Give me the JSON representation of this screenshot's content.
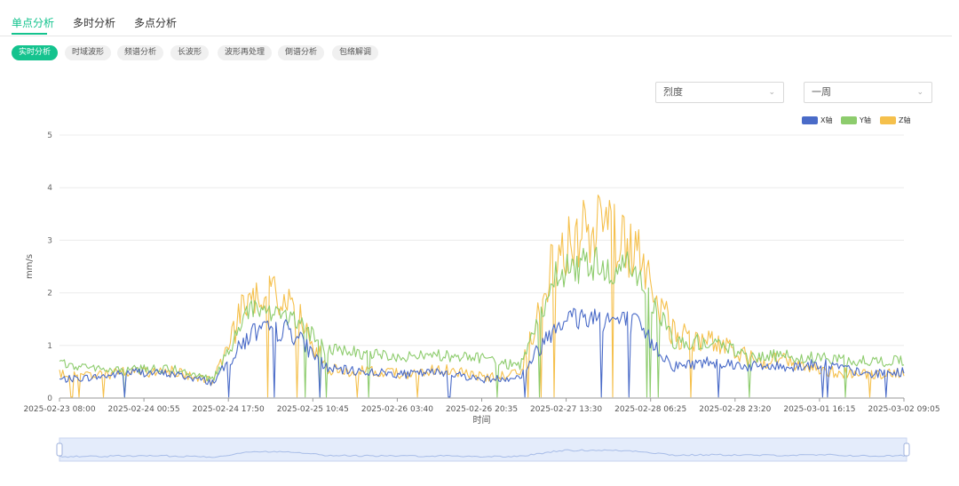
{
  "tabs": [
    {
      "label": "单点分析",
      "active": true
    },
    {
      "label": "多时分析",
      "active": false
    },
    {
      "label": "多点分析",
      "active": false
    }
  ],
  "subtabs": [
    {
      "label": "实时分析",
      "active": true
    },
    {
      "label": "时域波形",
      "active": false
    },
    {
      "label": "频谱分析",
      "active": false
    },
    {
      "label": "长波形",
      "active": false
    },
    {
      "label": "波形再处理",
      "active": false
    },
    {
      "label": "倒谱分析",
      "active": false
    },
    {
      "label": "包络解调",
      "active": false
    }
  ],
  "filters": {
    "metric": {
      "value": "烈度"
    },
    "range": {
      "value": "一周"
    }
  },
  "colors": {
    "accent": "#14c38e",
    "x": "#4a6bc8",
    "y": "#8dcc6d",
    "z": "#f5c04c"
  },
  "chart_data": {
    "type": "line",
    "ylabel": "mm/s",
    "xlabel": "时间",
    "ylim": [
      0,
      5
    ],
    "yticks": [
      0,
      1,
      2,
      3,
      4,
      5
    ],
    "xticks": [
      "2025-02-23 08:00",
      "2025-02-24 00:55",
      "2025-02-24 17:50",
      "2025-02-25 10:45",
      "2025-02-26 03:40",
      "2025-02-26 20:35",
      "2025-02-27 13:30",
      "2025-02-28 06:25",
      "2025-02-28 23:20",
      "2025-03-01 16:15",
      "2025-03-02 09:05"
    ],
    "x_positions": [
      0,
      0.1,
      0.2,
      0.3,
      0.4,
      0.5,
      0.6,
      0.7,
      0.8,
      0.9,
      1.0
    ],
    "grid": true,
    "legend": "top-right",
    "series": [
      {
        "name": "X轴",
        "color": "#4a6bc8",
        "values": [
          0.35,
          0.4,
          0.5,
          0.45,
          0.3,
          1.25,
          1.3,
          0.55,
          0.5,
          0.45,
          0.5,
          0.35,
          0.4,
          1.5,
          1.55,
          1.4,
          0.6,
          0.7,
          0.6,
          0.6,
          0.65,
          0.45,
          0.5
        ]
      },
      {
        "name": "Y轴",
        "color": "#8dcc6d",
        "values": [
          0.65,
          0.55,
          0.55,
          0.55,
          0.35,
          1.7,
          1.6,
          0.9,
          0.85,
          0.8,
          0.8,
          0.75,
          0.6,
          2.4,
          2.6,
          2.4,
          1.1,
          1.05,
          0.8,
          0.8,
          0.75,
          0.7,
          0.7
        ]
      },
      {
        "name": "Z轴",
        "color": "#f5c04c",
        "values": [
          0.45,
          0.45,
          0.5,
          0.5,
          0.3,
          2.1,
          1.8,
          0.55,
          0.5,
          0.45,
          0.55,
          0.4,
          0.45,
          2.9,
          3.2,
          2.8,
          1.2,
          1.05,
          0.75,
          0.7,
          0.5,
          0.45,
          0.5
        ]
      }
    ]
  }
}
